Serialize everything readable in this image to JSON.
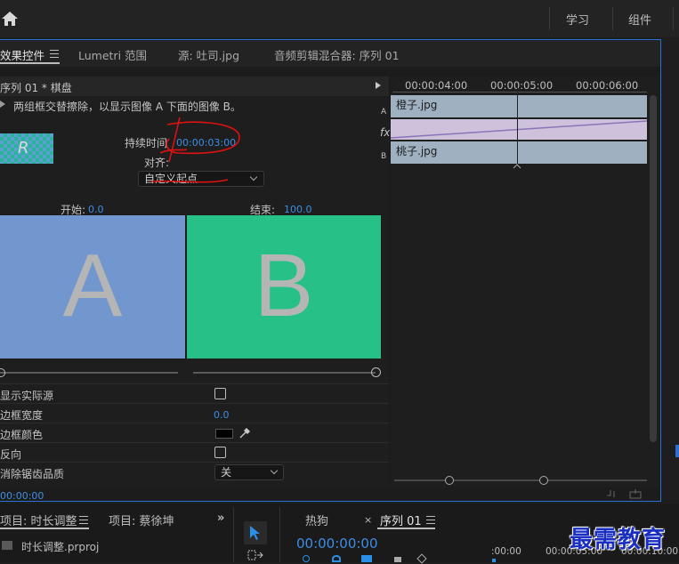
{
  "topbar": {
    "nav_items": [
      "学习",
      "组件"
    ]
  },
  "tabs": {
    "effect_controls": "效果控件",
    "lumetri": "Lumetri 范围",
    "source": "源: 吐司.jpg",
    "audio_mixer": "音频剪辑混合器: 序列 01"
  },
  "effect": {
    "header": "序列 01 * 棋盘",
    "description": "两组框交替擦除，以显示图像 A 下面的图像 B。",
    "duration_label": "持续时间",
    "duration_value": "00:00:03:00",
    "align_label": "对齐:",
    "align_value": "自定义起点",
    "start_label": "开始:",
    "start_value": "0.0",
    "end_label": "结束:",
    "end_value": "100.0",
    "preview_a": "A",
    "preview_b": "B",
    "start_slider_value": 0,
    "end_slider_value": 100
  },
  "properties": [
    {
      "label": "显示实际源",
      "type": "checkbox",
      "checked": false
    },
    {
      "label": "边框宽度",
      "type": "number",
      "value": "0.0"
    },
    {
      "label": "边框颜色",
      "type": "color",
      "value": "#000000"
    },
    {
      "label": "反向",
      "type": "checkbox",
      "checked": false
    },
    {
      "label": "消除锯齿品质",
      "type": "select",
      "value": "关"
    }
  ],
  "timeline": {
    "ruler": [
      "00:00:04:00",
      "00:00:05:00",
      "00:00:06:00"
    ],
    "track_a_label": "A",
    "track_fx_label": "fx",
    "track_b_label": "B",
    "clip_a": "橙子.jpg",
    "clip_b": "桃子.jpg"
  },
  "footer_timecode": "00:00:00",
  "bottom": {
    "project_tab": "项目: 时长调整",
    "project2_tab": "项目: 蔡徐坤",
    "project_file": "时长调整.prproj",
    "seq_tab_1": "热狗",
    "seq_tab_2": "序列 01",
    "timecode": "00:00:00:00",
    "ruler": [
      ":00:00",
      "00:00:05:00",
      "00:00:10:00"
    ]
  },
  "watermark": "最需教育",
  "colors": {
    "accent_blue": "#2b6fd6",
    "timecode_blue": "#3d8ee5",
    "preview_a_bg": "#7297cf",
    "preview_b_bg": "#27c187",
    "clip_bg": "#9fb1c1",
    "annotation_red": "#dd1111",
    "watermark": "#1a2ec2"
  }
}
